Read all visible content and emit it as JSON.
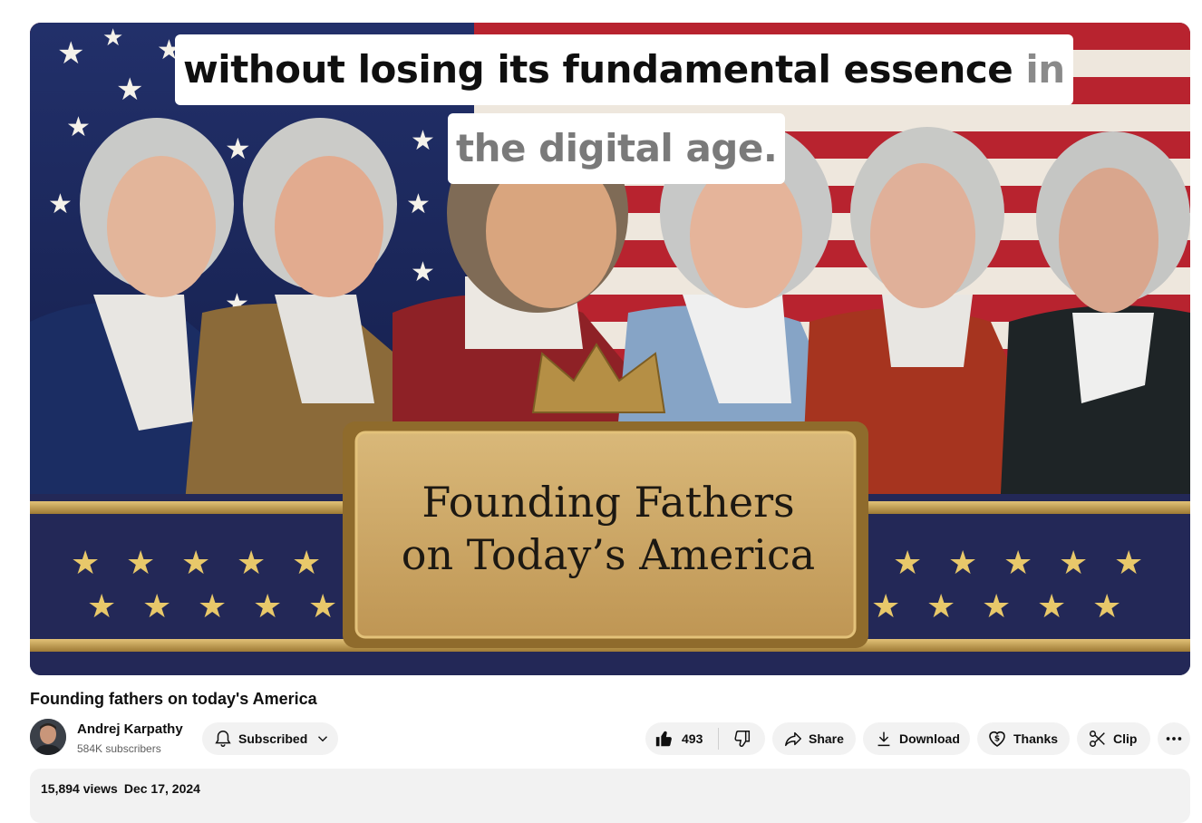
{
  "video": {
    "caption_line1": "without losing its fundamental essence",
    "caption_line1_dim": "in",
    "caption_line2": "the digital age.",
    "thumbnail_banner_line1": "Founding Fathers",
    "thumbnail_banner_line2": "on Today’s America",
    "title": "Founding fathers on today's America"
  },
  "channel": {
    "name": "Andrej Karpathy",
    "subscribers": "584K subscribers",
    "subscribe_label": "Subscribed"
  },
  "actions": {
    "like_count": "493",
    "share_label": "Share",
    "download_label": "Download",
    "thanks_label": "Thanks",
    "clip_label": "Clip"
  },
  "description": {
    "views": "15,894 views",
    "date": "Dec 17, 2024"
  },
  "colors": {
    "banner_navy": "#232857",
    "gold": "#c8a14e",
    "pill_bg": "#f2f2f2",
    "flag_red": "#b8232f"
  }
}
